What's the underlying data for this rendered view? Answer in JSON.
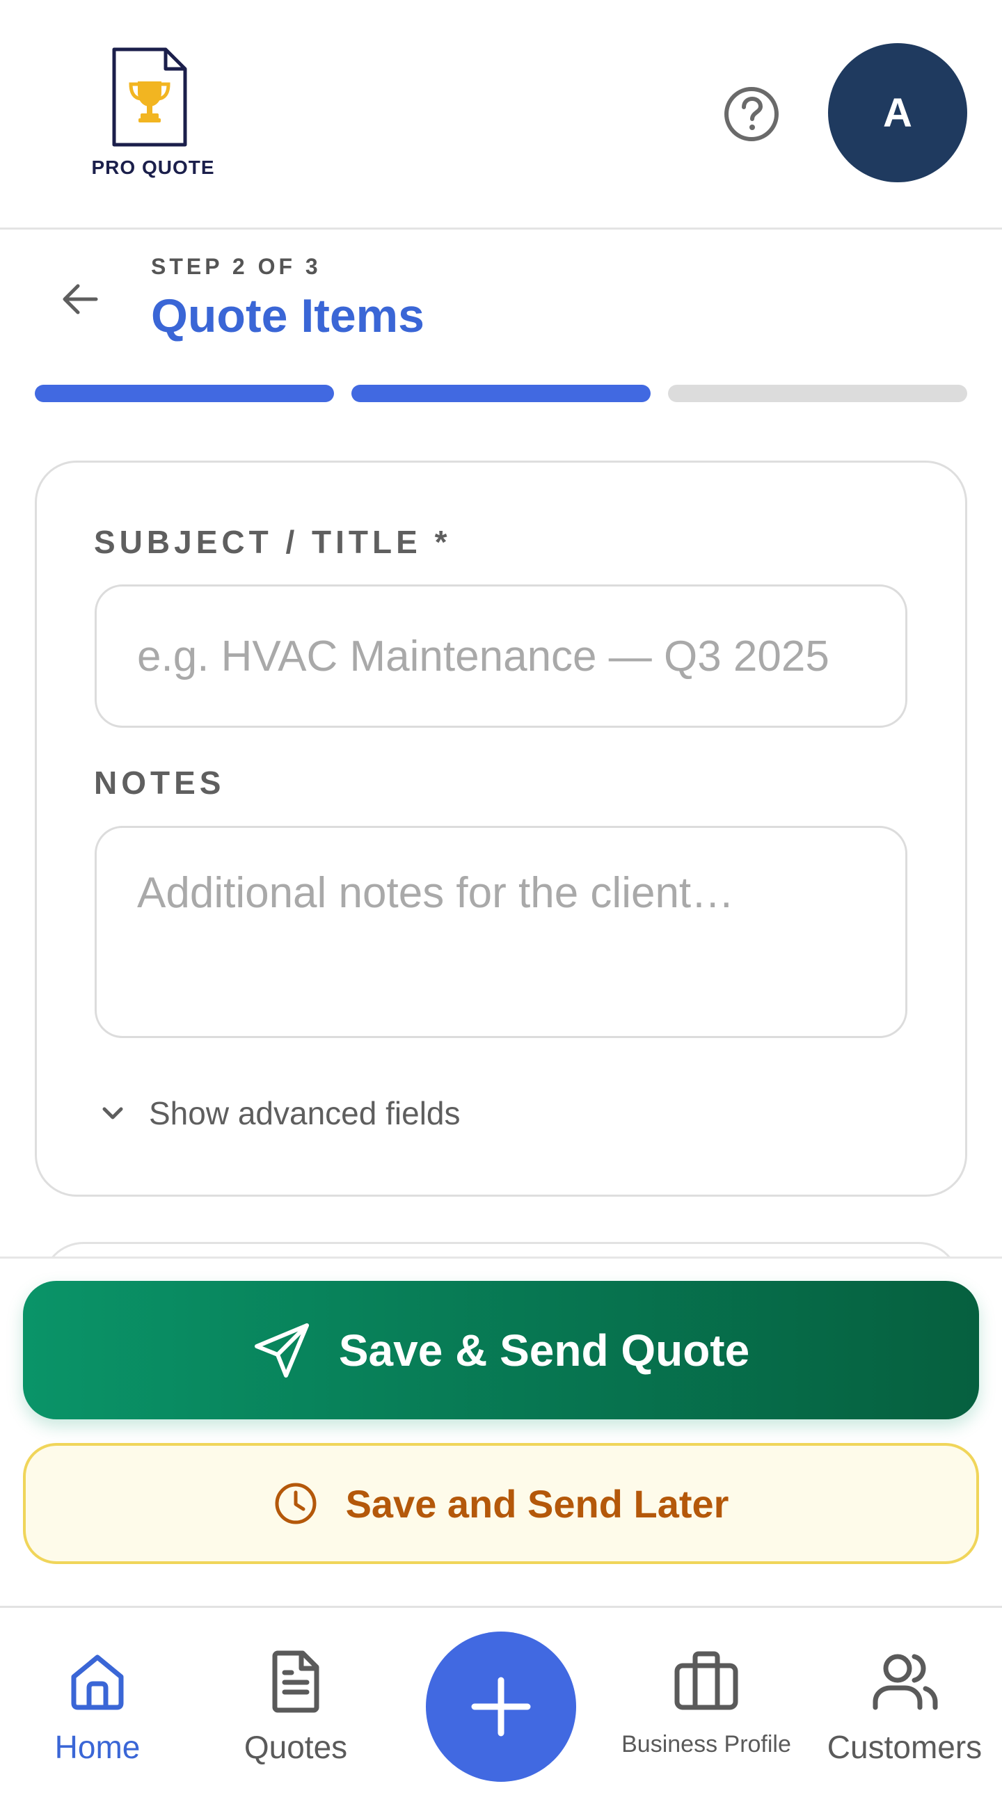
{
  "app": {
    "logo_text": "PRO QUOTE",
    "avatar_initial": "A"
  },
  "step": {
    "label": "STEP 2 OF 3",
    "title": "Quote Items",
    "current": 2,
    "total": 3
  },
  "form": {
    "subject_label": "SUBJECT / TITLE *",
    "subject_placeholder": "e.g. HVAC Maintenance — Q3 2025",
    "subject_value": "",
    "notes_label": "NOTES",
    "notes_placeholder": "Additional notes for the client…",
    "notes_value": "",
    "advanced_toggle_label": "Show advanced fields"
  },
  "actions": {
    "send_label": "Save & Send Quote",
    "later_label": "Save and Send Later"
  },
  "nav": {
    "home": "Home",
    "quotes": "Quotes",
    "business_profile": "Business Profile",
    "customers": "Customers",
    "active": "home"
  },
  "colors": {
    "accent_blue": "#4169e1",
    "title_blue": "#3a66d6",
    "avatar_navy": "#1f3a5f",
    "send_green": "#077651",
    "later_bg": "#fefbea",
    "later_border": "#f0d55a",
    "later_text": "#b4580a",
    "trophy_gold": "#f2b521"
  },
  "icons": {
    "logo": "document-trophy-icon",
    "help": "help-circle-icon",
    "back": "arrow-left-icon",
    "advanced": "chevron-down-icon",
    "send": "paper-plane-icon",
    "later": "clock-icon",
    "home": "home-icon",
    "quotes": "document-icon",
    "fab": "plus-icon",
    "business_profile": "briefcase-icon",
    "customers": "users-icon"
  }
}
